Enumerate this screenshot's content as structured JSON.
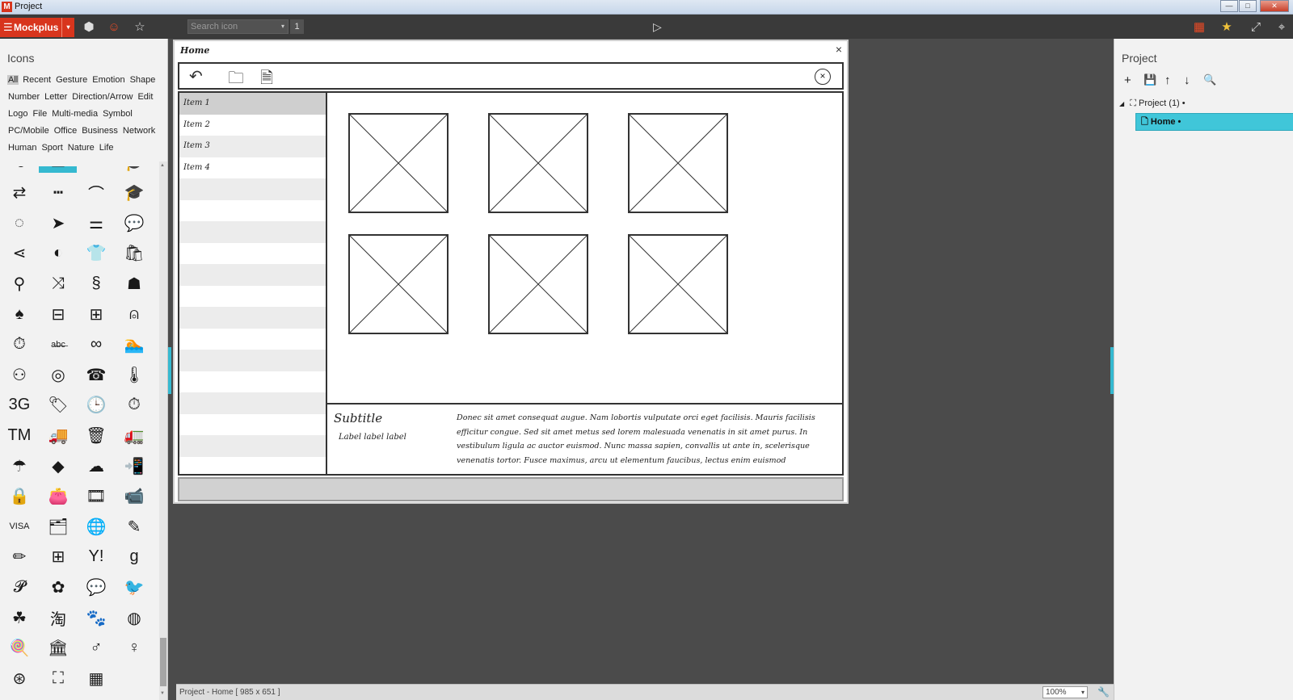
{
  "window": {
    "title": "Project",
    "app_icon": "M",
    "min_glyph": "—",
    "max_glyph": "□",
    "close_glyph": "✕"
  },
  "toolbar": {
    "brand": "Mockplus",
    "brand_menu_glyph": "☰",
    "brand_dd_glyph": "▾",
    "cube_glyph": "⬢",
    "emoji_glyph": "☺",
    "star_glyph": "☆",
    "search_placeholder": "Search icon",
    "search_dd_glyph": "▾",
    "search_count": "1",
    "play_glyph": "▷",
    "grid_glyph": "▦",
    "badge_glyph": "★",
    "fullscreen_glyph": "⤢",
    "pin_glyph": "⌖"
  },
  "icons_panel": {
    "heading": "Icons",
    "category_rows": [
      [
        "All",
        "Recent",
        "Gesture",
        "Emotion",
        "Shape"
      ],
      [
        "Number",
        "Letter",
        "Direction/Arrow",
        "Edit"
      ],
      [
        "Logo",
        "File",
        "Multi-media",
        "Symbol"
      ],
      [
        "PC/Mobile",
        "Office",
        "Business",
        "Network"
      ],
      [
        "Human",
        "Sport",
        "Nature",
        "Life"
      ]
    ],
    "active_category": "All",
    "icon_rows": [
      [
        "⟲",
        "▭",
        "⌒",
        "🎓"
      ],
      [
        "⇄",
        "┅",
        "⌒",
        "🎓"
      ],
      [
        "◌",
        "➤",
        "⚌",
        "💬"
      ],
      [
        "⋖",
        "◐",
        "👕",
        "🛍"
      ],
      [
        "⚲",
        "⤨",
        "§",
        "☗"
      ],
      [
        "♠",
        "⊟",
        "⊞",
        "⍝"
      ],
      [
        "⏱",
        "a̶b̶c̶",
        "∞",
        "🏊"
      ],
      [
        "⚇",
        "◎",
        "☎",
        "🌡"
      ],
      [
        "3G",
        "🏷",
        "🕒",
        "⏱"
      ],
      [
        "TM",
        "🚚",
        "🗑",
        "🚛"
      ],
      [
        "☂",
        "◆",
        "☁",
        "📲"
      ],
      [
        "🔒",
        "👛",
        "🎞",
        "📹"
      ],
      [
        "VISA",
        "🗂",
        "🌐",
        "✎"
      ],
      [
        "✏",
        "⊞",
        "Y!",
        "g"
      ],
      [
        "𝓟",
        "✿",
        "💬",
        "🐦"
      ],
      [
        "☘",
        "淘",
        "🐾",
        "◍"
      ],
      [
        "🍭",
        "🏛",
        "♂",
        "♀"
      ],
      [
        "⊛",
        "⛶",
        "▦",
        ""
      ]
    ]
  },
  "mockup": {
    "title": "Home",
    "close_glyph": "×",
    "nav_icons": [
      "↶",
      "🗀",
      "🗎"
    ],
    "nav_close_glyph": "×",
    "list_items": [
      "Item 1",
      "Item 2",
      "Item 3",
      "Item 4"
    ],
    "selected_item": "Item 1",
    "empty_rows": 14,
    "placeholder_count": 6,
    "subtitle": "Subtitle",
    "label": "Label label label",
    "paragraph": "Donec sit amet consequat augue. Nam lobortis vulputate orci eget facilisis. Mauris facilisis efficitur congue. Sed sit amet metus sed lorem malesuada venenatis in sit amet purus. In vestibulum ligula ac auctor euismod. Nunc massa sapien, convallis ut ante in, scelerisque venenatis tortor. Fusce maximus, arcu ut elementum faucibus, lectus enim euismod"
  },
  "project_panel": {
    "heading": "Project",
    "tools": [
      "+",
      "💾",
      "↑",
      "↓",
      "🔍"
    ],
    "root_label": "Project (1)",
    "root_dot": "•",
    "root_toggle": "◢",
    "home_label": "Home",
    "home_dot": "•",
    "page_glyph": "🗋",
    "tree_glyph": "⛶"
  },
  "status": {
    "info": "Project - Home [ 985 x 651 ]",
    "zoom": "100%",
    "zoom_dd": "▾",
    "wrench_glyph": "🔧"
  }
}
